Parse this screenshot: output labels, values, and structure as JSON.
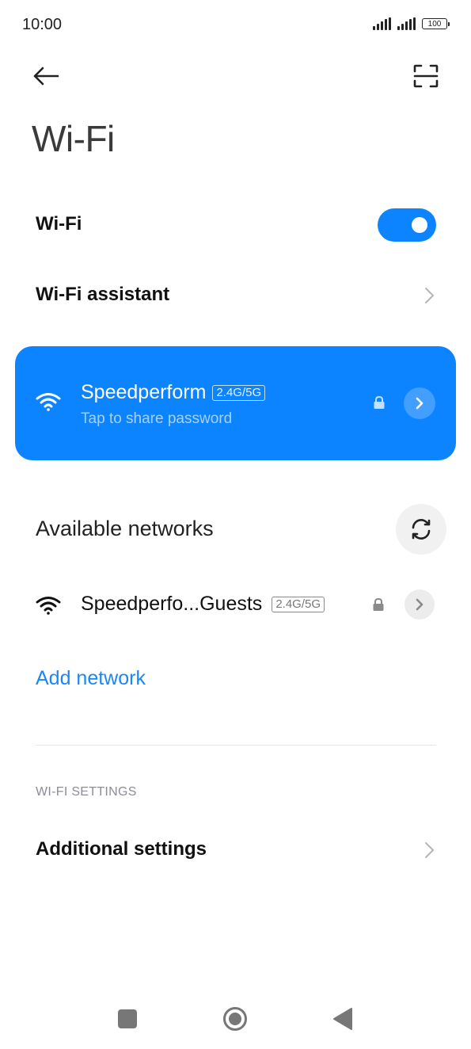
{
  "status_bar": {
    "time": "10:00",
    "battery": "100"
  },
  "header": {
    "title": "Wi-Fi",
    "back_icon": "arrow-left-icon",
    "scan_icon": "scan-frame-icon"
  },
  "wifi_toggle": {
    "label": "Wi-Fi",
    "enabled": true
  },
  "wifi_assistant": {
    "label": "Wi-Fi assistant"
  },
  "connected_network": {
    "ssid": "Speedperform",
    "band": "2.4G/5G",
    "subtitle": "Tap to share password",
    "secured": true
  },
  "available_networks": {
    "title": "Available networks",
    "items": [
      {
        "ssid": "Speedperfo...Guests",
        "band": "2.4G/5G",
        "secured": true
      }
    ],
    "add_label": "Add network"
  },
  "settings_section": {
    "header": "WI-FI SETTINGS",
    "additional_label": "Additional settings"
  },
  "colors": {
    "accent": "#0d84ff",
    "link": "#1a87f5"
  }
}
